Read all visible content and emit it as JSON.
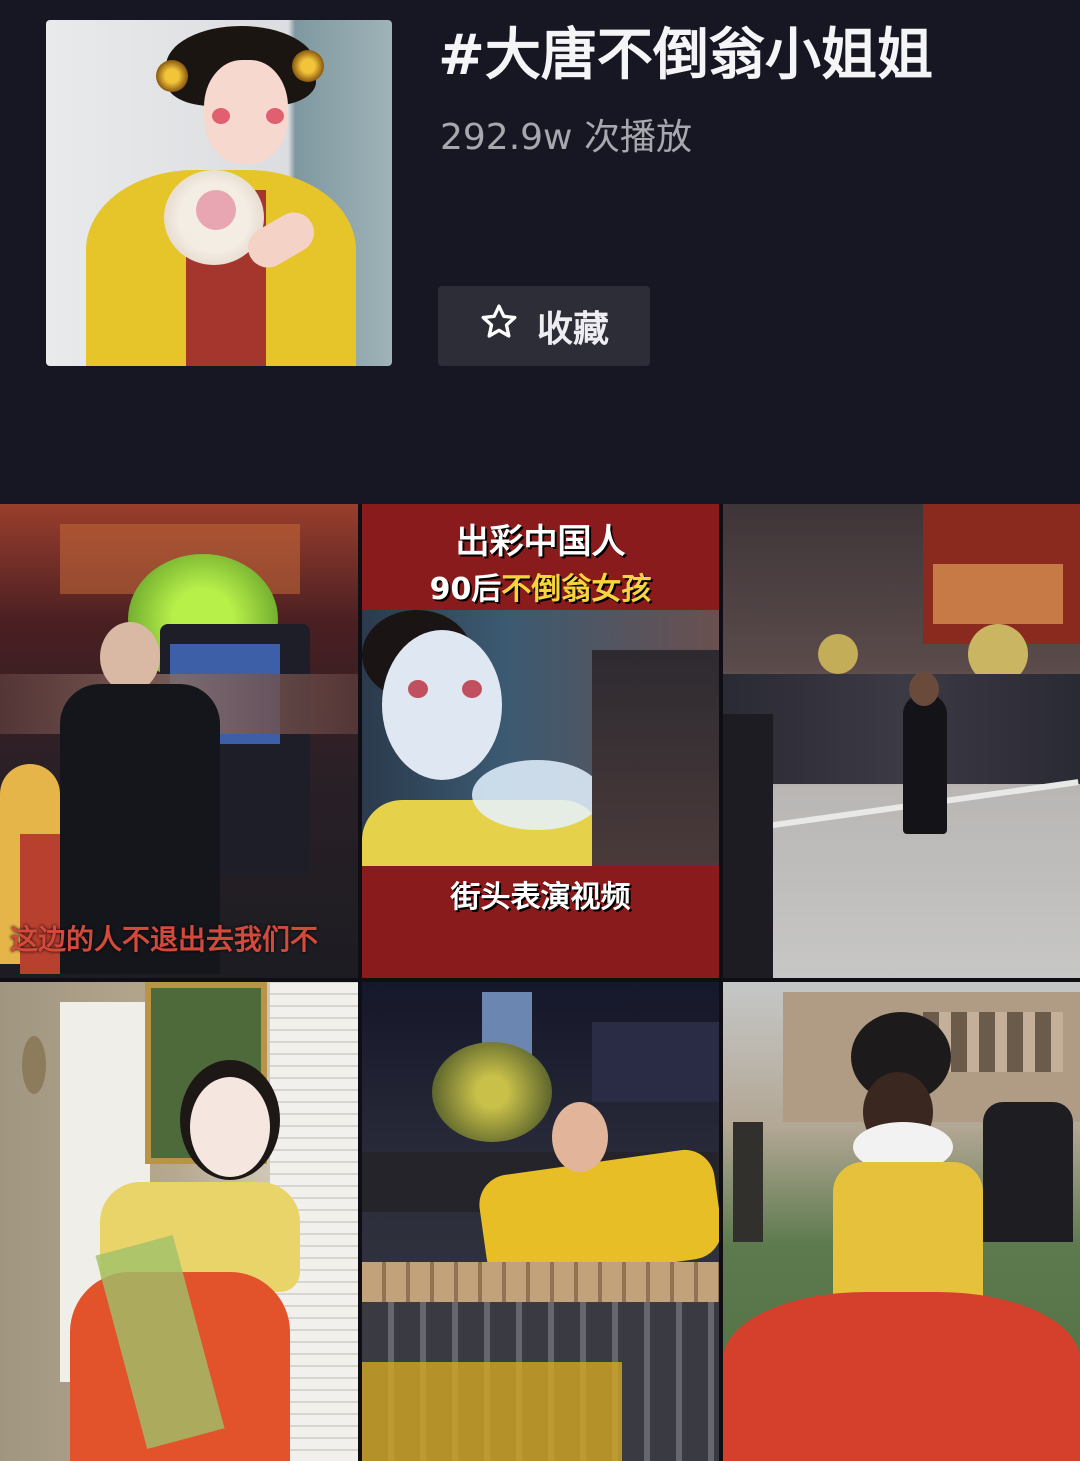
{
  "header": {
    "title": "#大唐不倒翁小姐姐",
    "plays": "292.9w 次播放",
    "favorite_label": "收藏"
  },
  "grid": {
    "tiles": [
      {
        "caption": "这边的人不退出去我们不"
      },
      {
        "line1": "出彩中国人",
        "line2_a": "90后",
        "line2_b": "不倒翁女孩",
        "line3": "街头表演视频"
      },
      {},
      {},
      {},
      {}
    ]
  },
  "colors": {
    "background": "#161722",
    "button_bg": "#2c2d36",
    "secondary_text": "#a7a8ae"
  },
  "icons": {
    "favorite": "star-outline-icon"
  }
}
